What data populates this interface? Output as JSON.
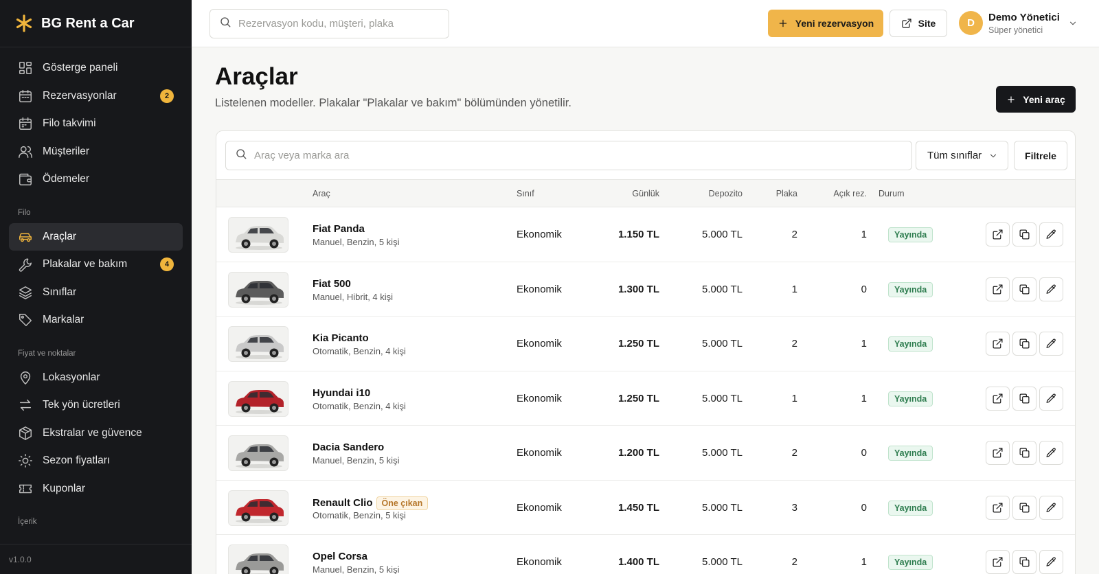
{
  "brand": {
    "name": "BG Rent a Car"
  },
  "sidebar": {
    "items": [
      {
        "label": "Gösterge paneli",
        "icon": "dashboard-icon"
      },
      {
        "label": "Rezervasyonlar",
        "icon": "calendar-icon",
        "badge": "2"
      },
      {
        "label": "Filo takvimi",
        "icon": "calendar-icon"
      },
      {
        "label": "Müşteriler",
        "icon": "users-icon"
      },
      {
        "label": "Ödemeler",
        "icon": "wallet-icon"
      }
    ],
    "section_fleet": "Filo",
    "fleet_items": [
      {
        "label": "Araçlar",
        "icon": "car-icon",
        "active": true
      },
      {
        "label": "Plakalar ve bakım",
        "icon": "wrench-icon",
        "badge": "4"
      },
      {
        "label": "Sınıflar",
        "icon": "layers-icon"
      },
      {
        "label": "Markalar",
        "icon": "tag-icon"
      }
    ],
    "section_pricing": "Fiyat ve noktalar",
    "pricing_items": [
      {
        "label": "Lokasyonlar",
        "icon": "map-pin-icon"
      },
      {
        "label": "Tek yön ücretleri",
        "icon": "arrows-icon"
      },
      {
        "label": "Ekstralar ve güvence",
        "icon": "package-icon"
      },
      {
        "label": "Sezon fiyatları",
        "icon": "sun-icon"
      },
      {
        "label": "Kuponlar",
        "icon": "ticket-icon"
      }
    ],
    "section_content": "İçerik",
    "version": "v1.0.0"
  },
  "topbar": {
    "search_placeholder": "Rezervasyon kodu, müşteri, plaka",
    "new_reservation_label": "Yeni rezervasyon",
    "site_label": "Site",
    "user_initial": "D",
    "user_name": "Demo Yönetici",
    "user_role": "Süper yönetici"
  },
  "page": {
    "title": "Araçlar",
    "subtitle": "Listelenen modeller. Plakalar \"Plakalar ve bakım\" bölümünden yönetilir.",
    "new_car_label": "Yeni araç"
  },
  "filters": {
    "search_placeholder": "Araç veya marka ara",
    "class_select": "Tüm sınıflar",
    "filter_label": "Filtrele"
  },
  "table": {
    "headers": {
      "car": "Araç",
      "class": "Sınıf",
      "daily": "Günlük",
      "deposit": "Depozito",
      "plate": "Plaka",
      "open": "Açık rez.",
      "status": "Durum"
    },
    "rows": [
      {
        "name": "Fiat Panda",
        "spec": "Manuel, Benzin, 5 kişi",
        "class": "Ekonomik",
        "daily": "1.150 TL",
        "deposit": "5.000 TL",
        "plates": "2",
        "open": "1",
        "status": "Yayında",
        "car_color": "#d9d9d6"
      },
      {
        "name": "Fiat 500",
        "spec": "Manuel, Hibrit, 4 kişi",
        "class": "Ekonomik",
        "daily": "1.300 TL",
        "deposit": "5.000 TL",
        "plates": "1",
        "open": "0",
        "status": "Yayında",
        "car_color": "#5b5b5b"
      },
      {
        "name": "Kia Picanto",
        "spec": "Otomatik, Benzin, 4 kişi",
        "class": "Ekonomik",
        "daily": "1.250 TL",
        "deposit": "5.000 TL",
        "plates": "2",
        "open": "1",
        "status": "Yayında",
        "car_color": "#c9c9c9"
      },
      {
        "name": "Hyundai i10",
        "spec": "Otomatik, Benzin, 4 kişi",
        "class": "Ekonomik",
        "daily": "1.250 TL",
        "deposit": "5.000 TL",
        "plates": "1",
        "open": "1",
        "status": "Yayında",
        "car_color": "#b3222a"
      },
      {
        "name": "Dacia Sandero",
        "spec": "Manuel, Benzin, 5 kişi",
        "class": "Ekonomik",
        "daily": "1.200 TL",
        "deposit": "5.000 TL",
        "plates": "2",
        "open": "0",
        "status": "Yayında",
        "car_color": "#a8a8a6"
      },
      {
        "name": "Renault Clio",
        "featured": "Öne çıkan",
        "spec": "Otomatik, Benzin, 5 kişi",
        "class": "Ekonomik",
        "daily": "1.450 TL",
        "deposit": "5.000 TL",
        "plates": "3",
        "open": "0",
        "status": "Yayında",
        "car_color": "#c0272d"
      },
      {
        "name": "Opel Corsa",
        "spec": "Manuel, Benzin, 5 kişi",
        "class": "Ekonomik",
        "daily": "1.400 TL",
        "deposit": "5.000 TL",
        "plates": "2",
        "open": "1",
        "status": "Yayında",
        "car_color": "#9a9a98"
      }
    ]
  },
  "colors": {
    "accent": "#f0b54a",
    "sidebar_bg": "#17181b",
    "status_green": "#2e7d4f"
  }
}
